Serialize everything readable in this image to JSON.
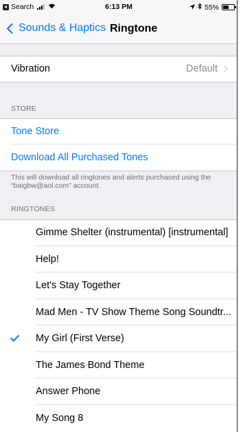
{
  "status_bar": {
    "back_label": "Search",
    "time": "6:13 PM",
    "battery": "55%",
    "battery_level": 0.55,
    "bluetooth_icon": "bluetooth-icon",
    "location_icon": "location-arrow-icon"
  },
  "nav": {
    "back_label": "Sounds & Haptics",
    "title": "Ringtone"
  },
  "vibration": {
    "label": "Vibration",
    "value": "Default"
  },
  "store": {
    "header": "STORE",
    "tone_store": "Tone Store",
    "download_all": "Download All Purchased Tones",
    "note": "This will download all ringtones and alerts purchased using the “baigbw@aol.com” account."
  },
  "ringtones": {
    "header": "RINGTONES",
    "selected_index": 4,
    "items": [
      "Gimme Shelter (instrumental) [instrumental]",
      "Help!",
      "Let's Stay Together",
      "Mad Men - TV Show Theme Song Soundtr...",
      "My Girl (First Verse)",
      "The James Bond Theme",
      "Answer Phone",
      "My Song 8"
    ]
  },
  "colors": {
    "accent": "#007aff",
    "background": "#efeff4",
    "secondary_text": "#6d6d72"
  }
}
